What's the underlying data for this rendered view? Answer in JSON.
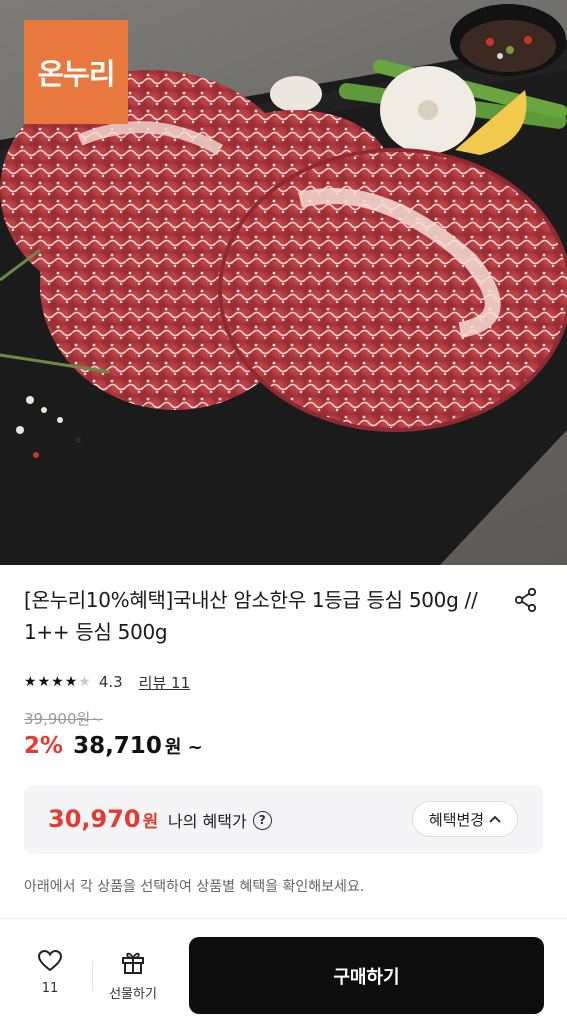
{
  "product": {
    "image_alt": "marbled hanwoo beef steaks on slate board",
    "brand_badge": "온누리",
    "title": "[온누리10%혜택]국내산 암소한우 1등급 등심 500g // 1++ 등심 500g",
    "share_icon": "share-icon"
  },
  "rating": {
    "stars_filled": 4,
    "stars_total": 5,
    "score": "4.3",
    "review_label": "리뷰 11"
  },
  "pricing": {
    "original_price": "39,900원~",
    "discount": "2%",
    "price": "38,710",
    "price_unit": "원 ~"
  },
  "benefit": {
    "price": "30,970",
    "unit": "원",
    "label": "나의 혜택가",
    "help_icon": "?",
    "change_button": "혜택변경",
    "change_chevron": "^"
  },
  "note": "아래에서 각 상품을 선택하여 상품별 혜택을 확인해보세요.",
  "bottom_bar": {
    "wish_count": "11",
    "gift_label": "선물하기",
    "buy_label": "구매하기"
  },
  "colors": {
    "accent": "#e8392f",
    "badge": "#e8783d",
    "buy_button": "#0d0d0d"
  }
}
